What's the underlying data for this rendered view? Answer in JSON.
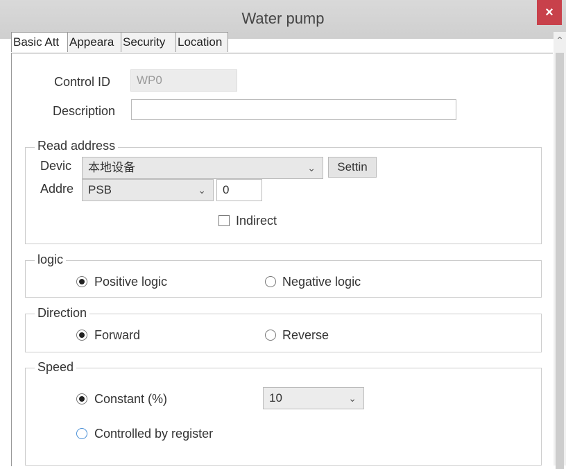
{
  "window": {
    "title": "Water pump",
    "close_label": "×"
  },
  "tabs": [
    {
      "label": "Basic Att"
    },
    {
      "label": "Appeara"
    },
    {
      "label": "Security"
    },
    {
      "label": "Location"
    }
  ],
  "basic": {
    "control_id_label": "Control ID",
    "control_id_value": "WP0",
    "description_label": "Description",
    "description_value": ""
  },
  "read_address": {
    "title": "Read address",
    "device_label": "Devic",
    "device_value": "本地设备",
    "settings_label": "Settin",
    "address_label": "Addre",
    "address_type": "PSB",
    "address_value": "0",
    "indirect_label": "Indirect",
    "indirect_checked": false
  },
  "logic": {
    "title": "logic",
    "options": [
      {
        "label": "Positive logic",
        "selected": true
      },
      {
        "label": "Negative logic",
        "selected": false
      }
    ]
  },
  "direction": {
    "title": "Direction",
    "options": [
      {
        "label": "Forward",
        "selected": true
      },
      {
        "label": "Reverse",
        "selected": false
      }
    ]
  },
  "speed": {
    "title": "Speed",
    "constant_label": "Constant (%)",
    "constant_selected": true,
    "constant_value": "10",
    "register_label": "Controlled by register",
    "register_selected": false
  },
  "icons": {
    "chevron": "chevron-down-icon",
    "scroll_up": "chevron-up-icon"
  }
}
